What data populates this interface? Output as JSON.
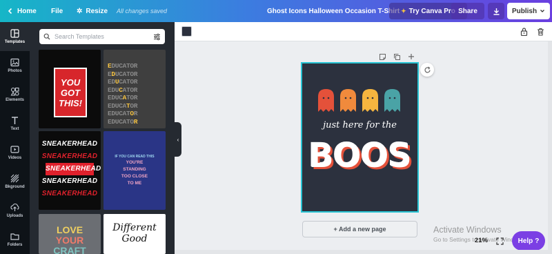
{
  "topbar": {
    "home_label": "Home",
    "file_label": "File",
    "resize_label": "Resize",
    "status": "All changes saved",
    "design_title": "Ghost Icons Halloween Occasion T-Shirt",
    "pro_label": "Try Canva Pro",
    "share_label": "Share",
    "publish_label": "Publish"
  },
  "rail": {
    "items": [
      {
        "label": "Templates",
        "icon": "templates-icon"
      },
      {
        "label": "Photos",
        "icon": "photo-icon"
      },
      {
        "label": "Elements",
        "icon": "elements-icon"
      },
      {
        "label": "Text",
        "icon": "text-icon"
      },
      {
        "label": "Videos",
        "icon": "video-icon"
      },
      {
        "label": "Bkground",
        "icon": "background-icon"
      },
      {
        "label": "Uploads",
        "icon": "upload-icon"
      },
      {
        "label": "Folders",
        "icon": "folder-icon"
      }
    ]
  },
  "panel": {
    "search_placeholder": "Search Templates",
    "templates": {
      "t1": {
        "line1": "YOU",
        "line2": "GOT",
        "line3": "THIS!"
      },
      "t2": {
        "rows": [
          "EDUCATOR",
          "EDUCATOR",
          "EDUCATOR",
          "EDUCATOR",
          "EDUCATOR",
          "EDUCATOR",
          "EDUCATOR",
          "EDUCATOR"
        ]
      },
      "t3": {
        "rows": [
          "SNEAKERHEAD",
          "SNEAKERHEAD",
          "SNEAKERHEAD",
          "SNEAKERHEAD",
          "SNEAKERHEAD"
        ]
      },
      "t4": {
        "small": "IF YOU CAN READ THIS",
        "big1": "YOU'RE",
        "big2": "STANDING",
        "big3": "TOO CLOSE",
        "big4": "TO ME"
      },
      "t5": {
        "line1": "LOVE",
        "line2": "YOUR",
        "line3": "CRAFT"
      },
      "t6": {
        "line1": "Different",
        "line2": "Good"
      }
    }
  },
  "canvas": {
    "tagline": "just here for the",
    "headline": "BOOS",
    "ghost_colors": [
      "#e4513a",
      "#f08a3c",
      "#f5b53f",
      "#4aa3a6"
    ],
    "add_page_label": "+ Add a new page"
  },
  "footer": {
    "watermark_title": "Activate Windows",
    "watermark_sub": "Go to Settings to activate Windows.",
    "zoom": "21%",
    "help_label": "Help",
    "help_glyph": "?"
  }
}
